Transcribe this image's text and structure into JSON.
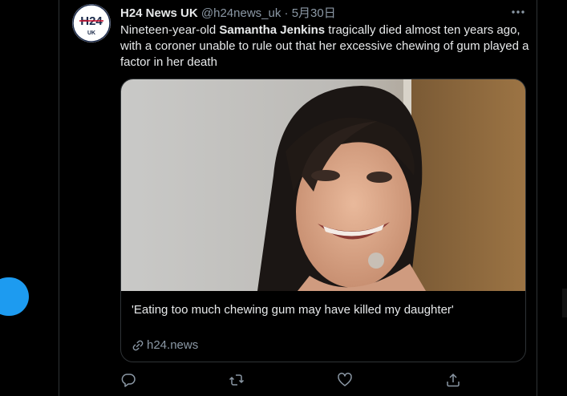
{
  "tweet": {
    "display_name": "H24 News UK",
    "handle": "@h24news_uk",
    "separator": "·",
    "time": "5月30日",
    "text_before": "Nineteen-year-old ",
    "text_bold": "Samantha Jenkins",
    "text_after": " tragically died almost ten years ago, with a coroner unable to rule out that her excessive chewing of gum played a factor in her death",
    "avatar_logo_text": "H24",
    "avatar_logo_sub": "UK"
  },
  "card": {
    "title": "'Eating too much chewing gum may have killed my daughter'",
    "domain": "h24.news"
  },
  "actions": [
    "reply-icon",
    "retweet-icon",
    "like-icon",
    "share-icon"
  ],
  "colors": {
    "background": "#000000",
    "accent": "#1d9bf0",
    "text": "#e7e9ea",
    "secondary_text": "#8b98a5",
    "border": "#2f3336"
  }
}
